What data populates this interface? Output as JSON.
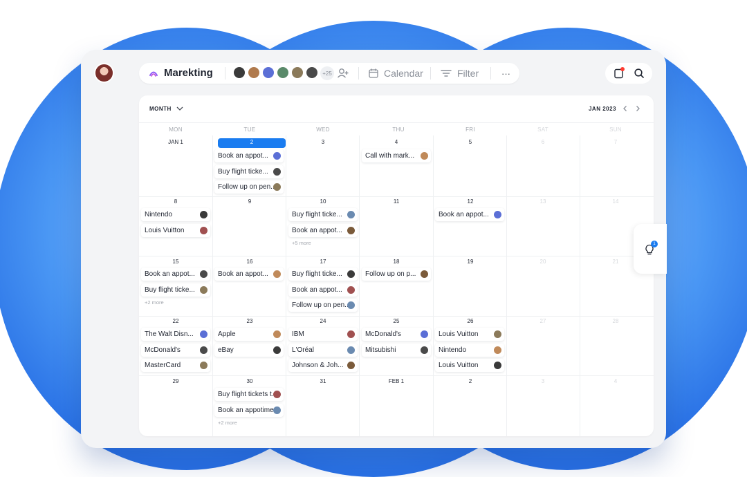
{
  "project": {
    "title": "Marekting",
    "members_more": "+25"
  },
  "toolbar": {
    "calendar_label": "Calendar",
    "filter_label": "Filter",
    "more_label": "···"
  },
  "calendar": {
    "view_label": "MONTH",
    "current_period": "JAN 2023",
    "weekdays": [
      "MON",
      "TUE",
      "WED",
      "THU",
      "FRI",
      "SAT",
      "SUN"
    ],
    "weeks": [
      [
        "JAN 1",
        "2",
        "3",
        "4",
        "5",
        "6",
        "7"
      ],
      [
        "8",
        "9",
        "10",
        "11",
        "12",
        "13",
        "14"
      ],
      [
        "15",
        "16",
        "17",
        "18",
        "19",
        "20",
        "21"
      ],
      [
        "22",
        "23",
        "24",
        "25",
        "26",
        "27",
        "28"
      ],
      [
        "29",
        "30",
        "31",
        "FEB 1",
        "2",
        "3",
        "4"
      ]
    ],
    "events": {
      "w0": {
        "tue": [
          "Book an appot...",
          "Buy flight ticke...",
          "Follow up on pen..."
        ],
        "thu": [
          "Call with mark..."
        ]
      },
      "w1": {
        "mon": [
          "Nintendo",
          "Louis Vuitton"
        ],
        "wed": [
          "Buy flight ticke...",
          "Book an appot..."
        ],
        "wed_more": "+5 more",
        "fri": [
          "Book an appot..."
        ]
      },
      "w2": {
        "mon": [
          "Book an appot...",
          "Buy flight ticke..."
        ],
        "mon_more": "+2 more",
        "tue": [
          "Book an appot..."
        ],
        "wed": [
          "Buy flight ticke...",
          "Book an appot...",
          "Follow up on pen..."
        ],
        "thu": [
          "Follow up on p..."
        ]
      },
      "w3": {
        "mon": [
          "The Walt Disn...",
          "McDonald's",
          "MasterCard"
        ],
        "tue": [
          "Apple",
          "eBay"
        ],
        "wed": [
          "IBM",
          "L'Oréal",
          "Johnson & Joh..."
        ],
        "thu": [
          "McDonald's",
          "Mitsubishi"
        ],
        "fri": [
          "Louis Vuitton",
          "Nintendo",
          "Louis Vuitton"
        ]
      },
      "w4": {
        "tue": [
          "Buy flight tickets t...",
          "Book an appotime..."
        ],
        "tue_more": "+2 more"
      }
    }
  },
  "side_panel": {
    "badge": "1"
  },
  "colors": {
    "accent": "#1a7cf0",
    "background_blob": "#3a86f0",
    "notification": "#ff3b30"
  }
}
